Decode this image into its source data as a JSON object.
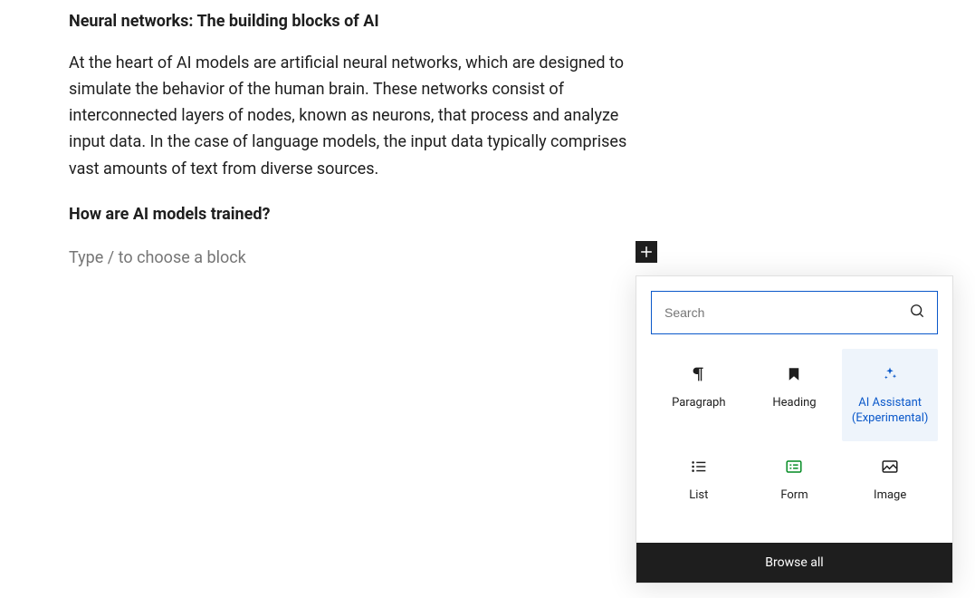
{
  "content": {
    "heading1": "Neural networks: The building blocks of AI",
    "paragraph1": "At the heart of AI models are artificial neural networks, which are designed to simulate the behavior of the human brain. These networks consist of interconnected layers of nodes, known as neurons, that process and analyze input data. In the case of language models, the input data typically comprises vast amounts of text from diverse sources.",
    "heading2": "How are AI models trained?",
    "placeholder": "Type / to choose a block"
  },
  "inserter": {
    "search_placeholder": "Search",
    "blocks": {
      "paragraph": "Paragraph",
      "heading": "Heading",
      "ai_assistant": "AI Assistant (Experimental)",
      "list": "List",
      "form": "Form",
      "image": "Image"
    },
    "browse_all": "Browse all"
  }
}
